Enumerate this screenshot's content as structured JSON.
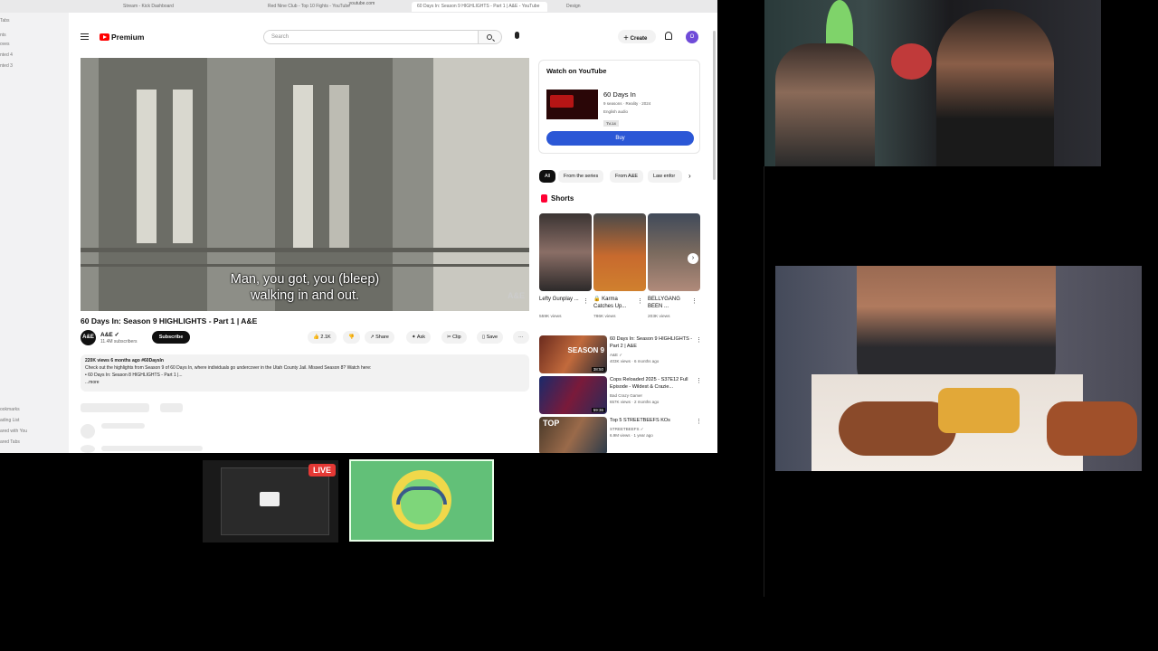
{
  "browser": {
    "url": "youtube.com",
    "tabs": [
      "Stream - Kick Dashboard",
      "Red Nine Club - Top 10 Fights - YouTube",
      "60 Days In: Season 9 HIGHLIGHTS - Part 1 | A&E - YouTube",
      "Design"
    ],
    "sidebar_items": [
      "Tabs",
      "nts",
      "oves",
      "nted 4",
      "nted 3",
      "ookmarks",
      "ading List",
      "ared with You",
      "ared Tabs"
    ]
  },
  "youtube": {
    "logo_text": "Premium",
    "search_placeholder": "Search",
    "create_label": "Create",
    "avatar_letter": "O",
    "video": {
      "caption_line1": "Man, you got, you (bleep)",
      "caption_line2": "walking in and out.",
      "watermark": "A&E",
      "title": "60 Days In: Season 9 HIGHLIGHTS - Part 1 | A&E",
      "channel": "A&E ✓",
      "channel_avatar": "A&E",
      "subscribers": "11.4M subscribers",
      "subscribe_label": "Subscribe",
      "likes": "2.1K",
      "share_label": "Share",
      "ask_label": "Ask",
      "clip_label": "Clip",
      "save_label": "Save",
      "more_label": "···",
      "desc_stats": "220K views  6 months ago  #60DaysIn",
      "desc_text": "Check out the highlights from Season 9 of 60 Days In, where individuals go undercover in the Utah County Jail. Missed Season 8? Watch here:",
      "desc_item": "• 60 Days In: Season 8 HIGHLIGHTS - Part 1 |...",
      "desc_more": "...more"
    },
    "watch_card": {
      "heading": "Watch on YouTube",
      "title": "60 Days In",
      "meta1": "9 seasons · Reality · 2024",
      "meta2": "English audio",
      "rating": "TV-14",
      "buy_label": "Buy"
    },
    "chips": [
      "All",
      "From the series",
      "From A&E",
      "Law enfor"
    ],
    "shorts_heading": "Shorts",
    "shorts": [
      {
        "title": "Lefty Gunplay ...",
        "views": "559K views"
      },
      {
        "title": "🔒 Karma Catches Up...",
        "views": "786K views"
      },
      {
        "title": "BELLYGANG BEEN ...",
        "views": "203K views"
      }
    ],
    "recommended": [
      {
        "title": "60 Days In: Season 9 HIGHLIGHTS - Part 2 | A&E",
        "channel": "A&E ✓",
        "meta": "403K views · 6 months ago",
        "thumb_text": "SEASON 9",
        "duration": "38:50"
      },
      {
        "title": "Cops Reloaded 2025 - S37E12 Full Episode - Wildest & Crazie...",
        "channel": "Bad Crazy Gamer",
        "meta": "657K views · 2 months ago",
        "thumb_text": "",
        "duration": "59:36"
      },
      {
        "title": "Top 5 STREETBEEFS KOs",
        "channel": "STREETBEEFS ✓",
        "meta": "6.9M views · 1 year ago",
        "thumb_text": "TOP",
        "duration": ""
      }
    ]
  },
  "overlay": {
    "live_label": "LIVE"
  }
}
